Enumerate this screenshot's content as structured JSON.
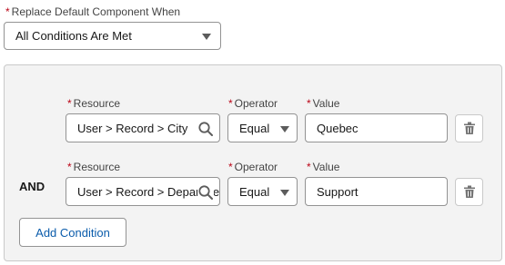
{
  "replace_when": {
    "label": "Replace Default Component When",
    "selected": "All Conditions Are Met"
  },
  "required_marker": "*",
  "conditions": [
    {
      "prefix": "",
      "resource_label": "Resource",
      "resource_value": "User > Record > City",
      "operator_label": "Operator",
      "operator_value": "Equal",
      "value_label": "Value",
      "value_value": "Quebec"
    },
    {
      "prefix": "AND",
      "resource_label": "Resource",
      "resource_value": "User > Record > Department",
      "operator_label": "Operator",
      "operator_value": "Equal",
      "value_label": "Value",
      "value_value": "Support"
    }
  ],
  "add_condition_label": "Add Condition",
  "icons": {
    "resource_search": "search-icon",
    "delete": "trash-icon",
    "dropdown": "chevron-down-icon"
  }
}
